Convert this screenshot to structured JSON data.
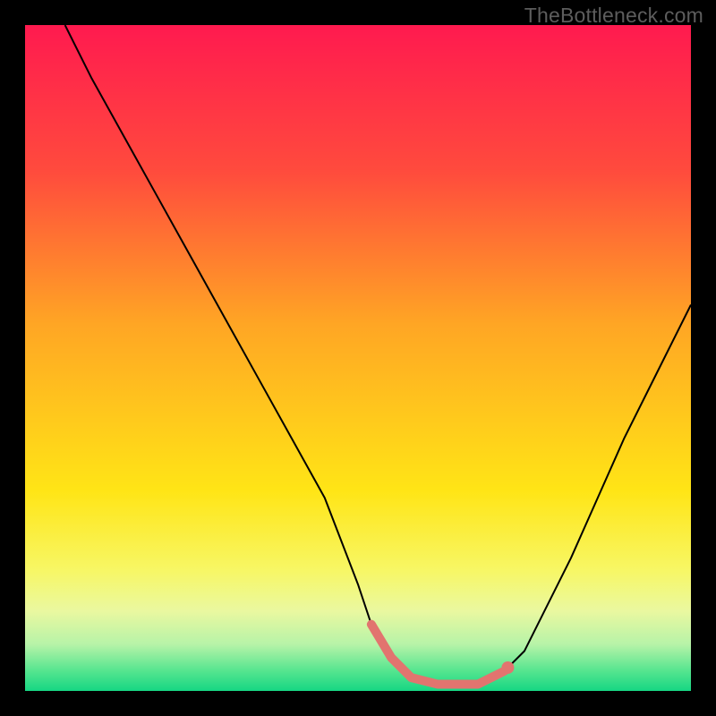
{
  "watermark": "TheBottleneck.com",
  "chart_data": {
    "type": "line",
    "title": "",
    "xlabel": "",
    "ylabel": "",
    "xlim": [
      0,
      100
    ],
    "ylim": [
      0,
      100
    ],
    "grid": false,
    "legend": false,
    "gradient_stops": [
      {
        "offset": 0,
        "color": "#ff1a4f"
      },
      {
        "offset": 0.22,
        "color": "#ff4b3d"
      },
      {
        "offset": 0.45,
        "color": "#ffa624"
      },
      {
        "offset": 0.7,
        "color": "#ffe516"
      },
      {
        "offset": 0.82,
        "color": "#f7f766"
      },
      {
        "offset": 0.88,
        "color": "#eaf8a0"
      },
      {
        "offset": 0.93,
        "color": "#b7f3a8"
      },
      {
        "offset": 0.97,
        "color": "#55e58f"
      },
      {
        "offset": 1.0,
        "color": "#16d683"
      }
    ],
    "series": [
      {
        "name": "bottleneck-curve",
        "stroke": "#000000",
        "stroke_width": 2,
        "x": [
          6,
          10,
          15,
          20,
          25,
          30,
          35,
          40,
          45,
          50,
          52,
          55,
          58,
          62,
          65,
          68,
          70,
          72,
          75,
          78,
          82,
          86,
          90,
          95,
          100
        ],
        "y": [
          100,
          92,
          83,
          74,
          65,
          56,
          47,
          38,
          29,
          16,
          10,
          5,
          2,
          1,
          1,
          1,
          2,
          3,
          6,
          12,
          20,
          29,
          38,
          48,
          58
        ]
      },
      {
        "name": "optimal-range",
        "stroke": "#e2746f",
        "stroke_width": 10,
        "linecap": "round",
        "x": [
          52,
          55,
          58,
          62,
          65,
          68,
          70,
          72
        ],
        "y": [
          10,
          5,
          2,
          1,
          1,
          1,
          2,
          3
        ]
      }
    ],
    "markers": [
      {
        "name": "optimal-endpoint",
        "x": 72.5,
        "y": 3.5,
        "r": 7,
        "fill": "#e2746f"
      }
    ]
  }
}
